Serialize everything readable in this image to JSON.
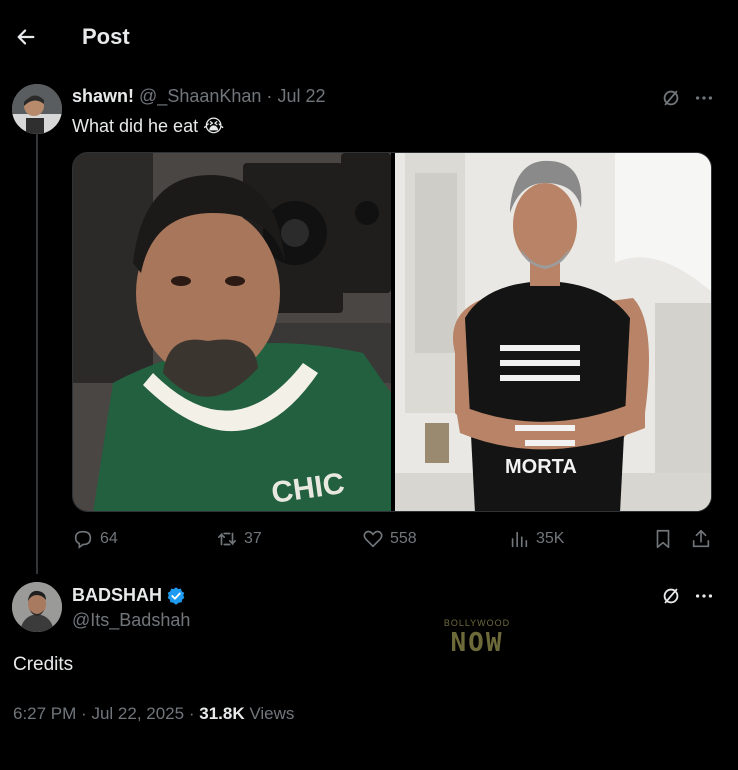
{
  "header": {
    "title": "Post",
    "back_icon": "arrow-left-icon"
  },
  "tweet": {
    "display_name": "shawn!",
    "handle": "@_ShaanKhan",
    "separator": "·",
    "date": "Jul 22",
    "text": "What did he eat 😭",
    "media": [
      {
        "description": "man in green jersey in studio",
        "jersey_text": "CHIC"
      },
      {
        "description": "man in black sleeveless shirt with crossed arms",
        "shirt_text": "MORTA"
      }
    ],
    "stats": {
      "replies": "64",
      "reposts": "37",
      "likes": "558",
      "views": "35K"
    }
  },
  "reply": {
    "display_name": "BADSHAH",
    "handle": "@Its_Badshah",
    "verified": true,
    "text": "Credits",
    "time": "6:27 PM",
    "separator": "·",
    "date": "Jul 22, 2025",
    "separator2": "·",
    "views_count": "31.8K",
    "views_label": "Views"
  },
  "watermark": {
    "top": "BOLLYWOOD",
    "main": "NOW"
  },
  "colors": {
    "background": "#000000",
    "text": "#e7e9ea",
    "muted": "#71767b",
    "verified": "#1d9bf0"
  }
}
